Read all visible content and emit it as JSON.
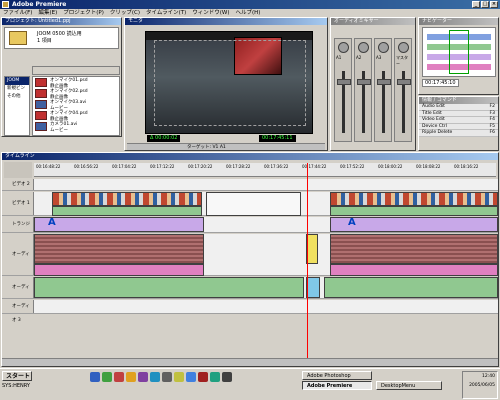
{
  "app": {
    "title": "Adobe Premiere"
  },
  "menu": [
    "ファイル(F)",
    "編集(E)",
    "プロジェクト(P)",
    "クリップ(C)",
    "タイムライン(T)",
    "ウィンドウ(W)",
    "ヘルプ(H)"
  ],
  "project": {
    "title": "プロジェクト: Untitled1.ppj",
    "header": "JOOM 0500 読込用",
    "subheader": "1 項目",
    "bins": [
      "JOOM 0500",
      "新規ビン",
      "その他"
    ],
    "items": [
      {
        "name": "オンマイク01.psd",
        "meta": "静止画像"
      },
      {
        "name": "オンマイク02.psd",
        "meta": "静止画像"
      },
      {
        "name": "オンマイク03.avi",
        "meta": "ムービー"
      },
      {
        "name": "オンマイク04.psd",
        "meta": "静止画像"
      },
      {
        "name": "カメラ01.avi",
        "meta": "ムービー"
      }
    ]
  },
  "monitor": {
    "title": "モニタ",
    "tc_left": "00:17:45:10",
    "tc_mid": "Δ 00:00:02",
    "tc_right": "00:17:45:11",
    "target": "ターゲット: V1 A1"
  },
  "mixer": {
    "title": "オーディオミキサー",
    "channels": [
      "A1",
      "A2",
      "A3",
      "マスター"
    ]
  },
  "navigator": {
    "title": "ナビゲーター",
    "timecode": "00:17:45:10"
  },
  "commands": {
    "title": "情報 / コマンド",
    "rows": [
      {
        "label": "Audio Edit",
        "key": "F2"
      },
      {
        "label": "Title Edit",
        "key": "F3"
      },
      {
        "label": "Video Edit",
        "key": "F4"
      },
      {
        "label": "Device Ctrl",
        "key": "F5"
      },
      {
        "label": "Ripple Delete",
        "key": "F6"
      }
    ]
  },
  "timeline": {
    "title": "タイムライン",
    "ticks": [
      "00:16:48:22",
      "00:16:56:22",
      "00:17:04:22",
      "00:17:12:22",
      "00:17:20:22",
      "00:17:28:22",
      "00:17:36:22",
      "00:17:44:22",
      "00:17:52:22",
      "00:18:00:22",
      "00:18:08:22",
      "00:18:16:22"
    ],
    "tracks": [
      "ビデオ 2",
      "ビデオ 1",
      "トランジション",
      "オーディオ 1",
      "オーディオ 2",
      "オーディオ 3"
    ]
  },
  "taskbar": {
    "start": "スタート",
    "user": "SYS:HENRY",
    "tasks": [
      "Adobe Photoshop",
      "Adobe Premiere",
      "DesktopMenu"
    ],
    "time": "12:40",
    "date": "2005/06/05"
  }
}
